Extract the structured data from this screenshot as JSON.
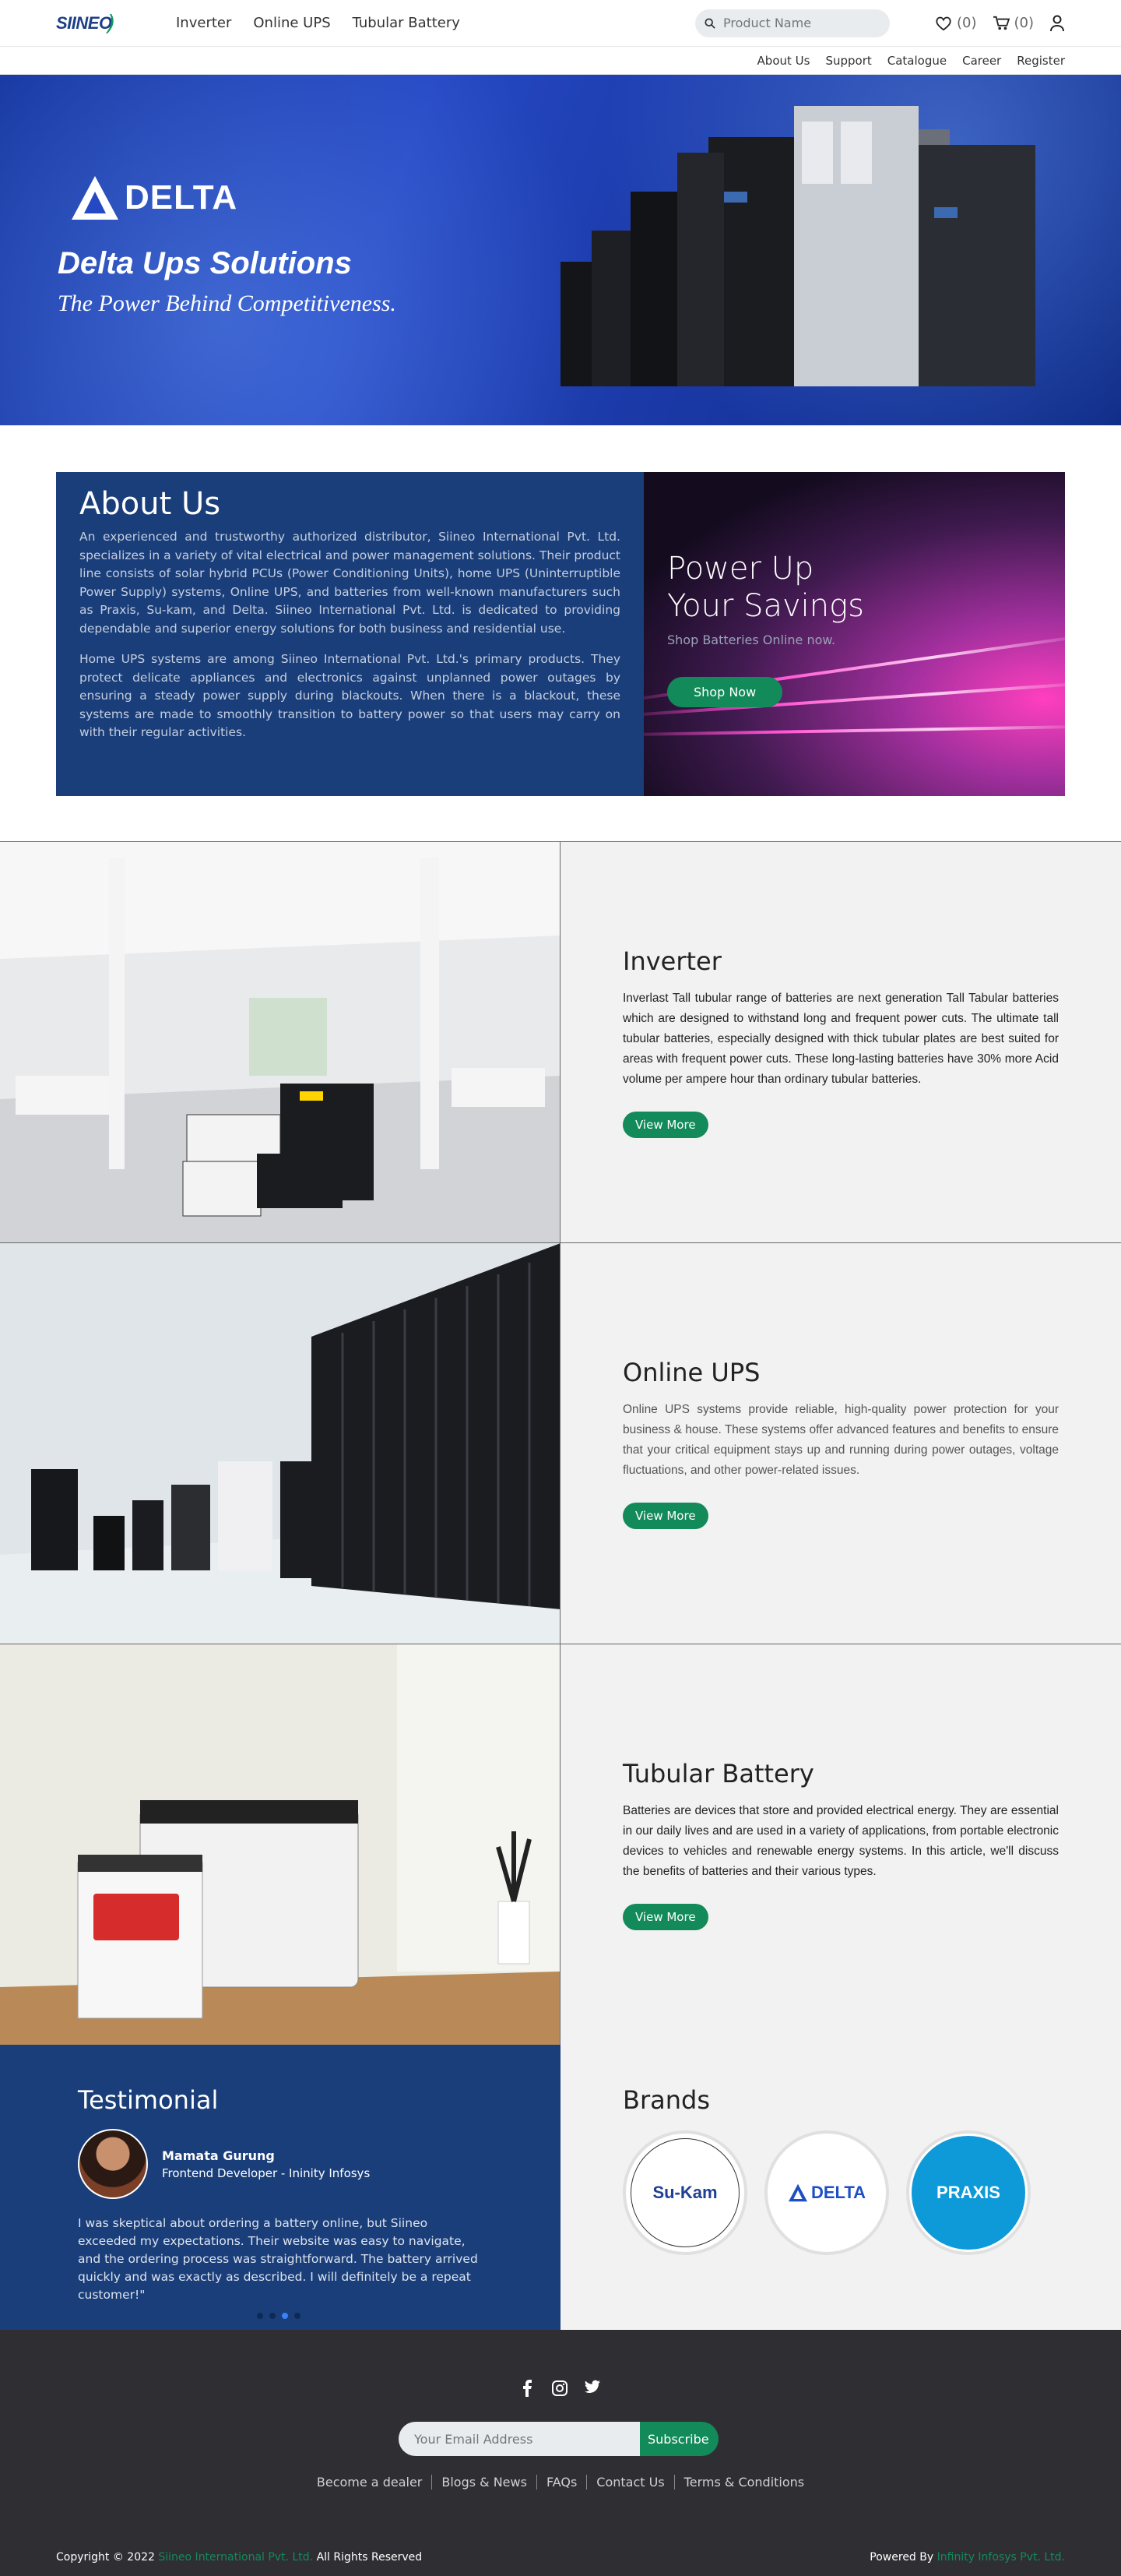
{
  "header": {
    "logo_text": "SIINEO",
    "nav": [
      "Inverter",
      "Online UPS",
      "Tubular Battery"
    ],
    "search_placeholder": "Product Name",
    "wishlist_count": "(0)",
    "cart_count": "(0)"
  },
  "subnav": [
    "About Us",
    "Support",
    "Catalogue",
    "Career",
    "Register"
  ],
  "hero": {
    "brand": "DELTA",
    "title": "Delta Ups Solutions",
    "tagline": "The Power Behind Competitiveness."
  },
  "about": {
    "title": "About Us",
    "paragraphs": [
      "An experienced and trustworthy authorized distributor, Siineo International Pvt. Ltd. specializes in a variety of vital electrical and power management solutions. Their product line consists of solar hybrid PCUs (Power Conditioning Units), home UPS (Uninterruptible Power Supply) systems, Online UPS, and batteries from well-known manufacturers such as Praxis, Su-kam, and Delta. Siineo International Pvt. Ltd. is dedicated to providing dependable and superior energy solutions for both business and residential use.",
      "Home UPS systems are among Siineo International Pvt. Ltd.'s primary products. They protect delicate appliances and electronics against unplanned power outages by ensuring a  steady power supply during blackouts. When there is a blackout, these systems are made to smoothly transition to battery power so that users may carry on with their regular activities."
    ],
    "promo_line1": "Power Up",
    "promo_line2": "Your Savings",
    "promo_sub": "Shop Batteries Online now.",
    "promo_button": "Shop Now"
  },
  "products": [
    {
      "title": "Inverter",
      "text": "Inverlast Tall tubular range of batteries are next generation Tall Tabular batteries which are designed to withstand long and frequent power cuts. The ultimate tall tubular batteries, especially designed with thick tubular plates are best suited for areas with frequent power cuts. These long-lasting batteries have 30% more Acid volume per ampere hour than ordinary tubular batteries.",
      "button": "View More"
    },
    {
      "title": "Online UPS",
      "text": "Online UPS systems provide reliable, high-quality power protection for your business & house. These systems offer advanced features and benefits to ensure that your critical equipment stays up and running during power outages, voltage fluctuations, and other power-related issues.",
      "button": "View More"
    },
    {
      "title": "Tubular Battery",
      "text": "Batteries are devices that store and provided electrical energy. They are essential in our daily lives and are used in a variety of applications, from portable electronic devices to vehicles and renewable energy systems. In this article, we'll discuss the benefits of batteries and their various types.",
      "button": "View More"
    }
  ],
  "testimonial": {
    "title": "Testimonial",
    "name": "Mamata Gurung",
    "role": "Frontend Developer - Ininity Infosys",
    "quote": "I was skeptical about ordering a battery online, but Siineo exceeded my expectations. Their website was easy to navigate, and the ordering process was straightforward. The battery arrived quickly and was exactly as described. I will definitely be a repeat customer!\""
  },
  "brands": {
    "title": "Brands",
    "items": [
      "Su-Kam",
      "DELTA",
      "PRAXIS"
    ]
  },
  "footer": {
    "email_placeholder": "Your Email Address",
    "subscribe": "Subscribe",
    "links": [
      "Become a dealer",
      "Blogs & News",
      "FAQs",
      "Contact Us",
      "Terms & Conditions"
    ],
    "copyright_prefix": "Copyright © 2022",
    "company": "Siineo International Pvt. Ltd.",
    "rights": "All Rights Reserved",
    "powered_prefix": "Powered By",
    "powered_company": "Infinity Infosys Pvt. Ltd."
  },
  "colors": {
    "accent_green": "#138a5a",
    "navy": "#1a3e79",
    "footer_bg": "#2f2f33"
  }
}
